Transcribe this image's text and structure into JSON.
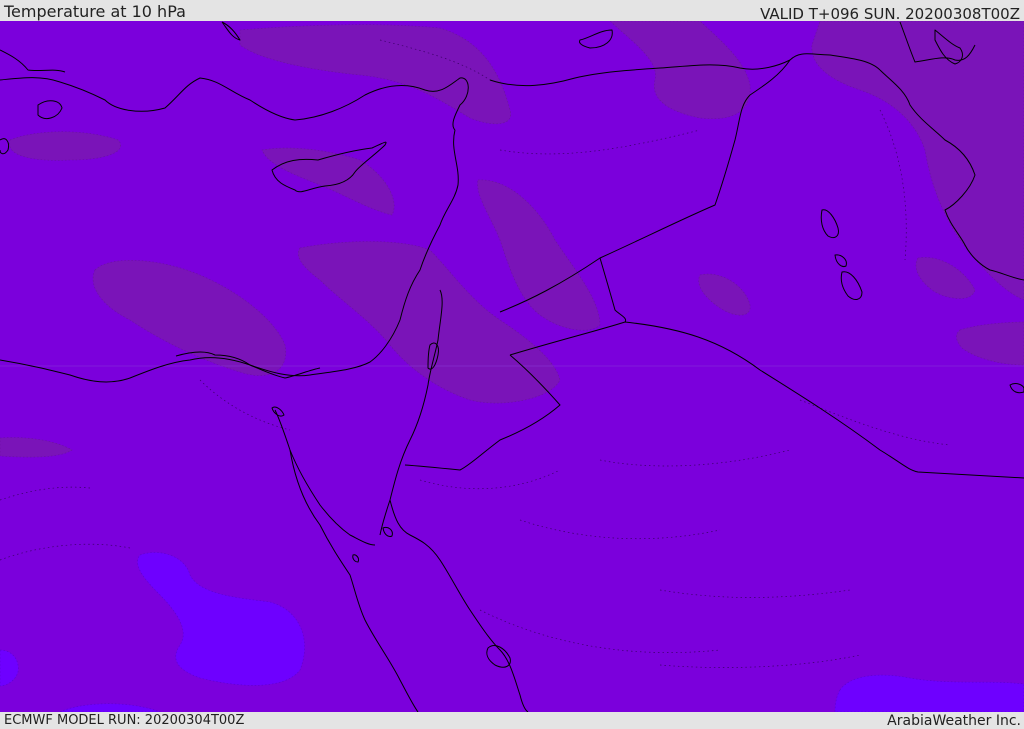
{
  "header": {
    "title": "Temperature at 10 hPa",
    "valid_time": "VALID T+096 SUN. 20200308T00Z"
  },
  "footer": {
    "model_run": "ECMWF MODEL RUN: 20200304T00Z",
    "credit": "ArabiaWeather Inc."
  },
  "map": {
    "region": "Eastern Mediterranean / Middle East",
    "colors": {
      "base_fill": "#7b00dc",
      "warmer_patch": "#7a14b8",
      "colder_patch": "#6e00ff",
      "coastline": "#000000",
      "contour": "#3a0066"
    }
  }
}
